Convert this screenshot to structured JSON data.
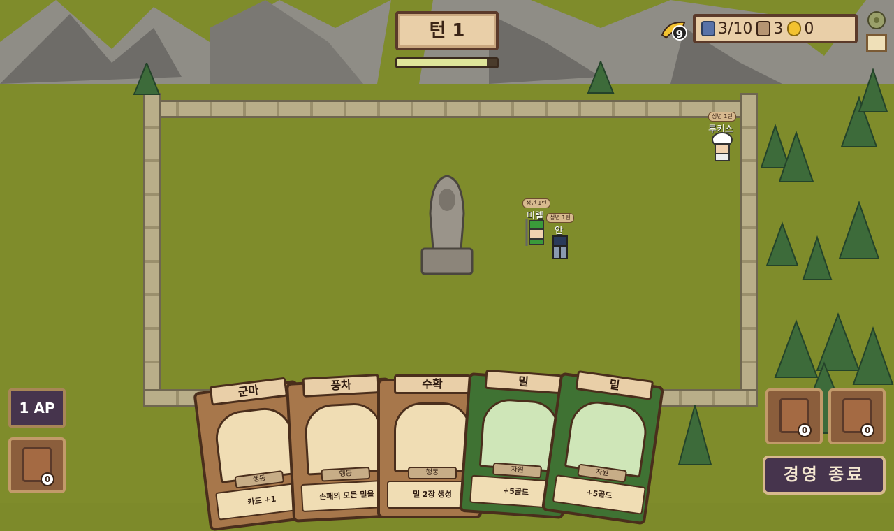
{
  "top": {
    "turn_label": "턴 1",
    "turn_progress": 0.9
  },
  "resources": {
    "horn_count": "9",
    "population": "3/10",
    "cards": "3",
    "gold": "0"
  },
  "units": [
    {
      "name": "루키스",
      "tag": "성년 1턴"
    },
    {
      "name": "미렐",
      "tag": "성년 1턴"
    },
    {
      "name": "안",
      "tag": "성년 1턴"
    }
  ],
  "ap_label": "1 AP",
  "deck_counts": {
    "draw_pile": "0",
    "left_pile": "0",
    "right_pile": "0"
  },
  "end_button_label": "경영 종료",
  "hand": [
    {
      "title": "군마",
      "type": "행동",
      "desc": "카드 +1"
    },
    {
      "title": "풍차",
      "type": "행동",
      "desc": "손패의 모든 밀을"
    },
    {
      "title": "수확",
      "type": "행동",
      "desc": "밀 2장 생성"
    },
    {
      "title": "밀",
      "type": "자원",
      "desc": "+5골드"
    },
    {
      "title": "밀",
      "type": "자원",
      "desc": "+5골드"
    }
  ],
  "colors": {
    "grass": "#7f8c2b",
    "panel": "#e9cfa8",
    "panel_border": "#5b3a2a",
    "ap_bg": "#46344d"
  }
}
